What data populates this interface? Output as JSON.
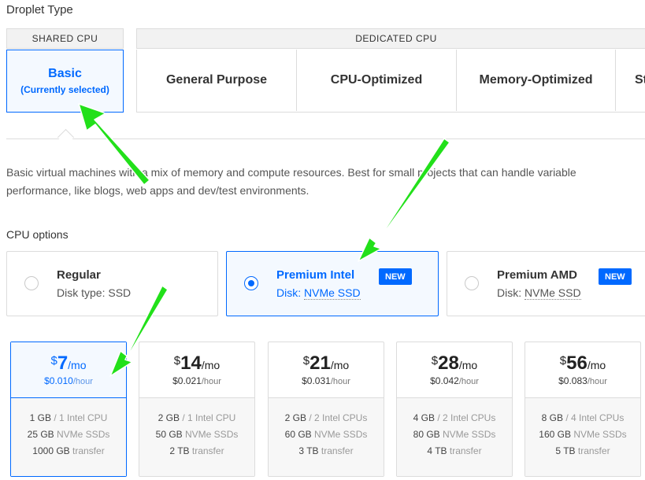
{
  "droplet_type": {
    "title": "Droplet Type"
  },
  "tabs": {
    "shared": {
      "header": "SHARED CPU",
      "name": "Basic",
      "status": "(Currently selected)"
    },
    "dedicated": {
      "header": "DEDICATED CPU",
      "items": [
        "General Purpose",
        "CPU-Optimized",
        "Memory-Optimized",
        "St"
      ]
    }
  },
  "description": {
    "line1": "Basic virtual machines with a mix of memory and compute resources. Best for small projects that can handle variable",
    "line2": "performance, like blogs, web apps and dev/test environments."
  },
  "cpu_options": {
    "title": "CPU options",
    "items": [
      {
        "name": "Regular",
        "disk_label": "Disk type: ",
        "disk": "SSD",
        "selected": false
      },
      {
        "name": "Premium Intel",
        "disk_label": "Disk: ",
        "disk": "NVMe SSD",
        "badge": "NEW",
        "selected": true
      },
      {
        "name": "Premium AMD",
        "disk_label": "Disk: ",
        "disk": "NVMe SSD",
        "badge": "NEW",
        "selected": false
      }
    ]
  },
  "plans": [
    {
      "currency": "$",
      "price": "7",
      "period": "/mo",
      "hourly": "$0.010",
      "hourly_unit": "/hour",
      "memory": "1 GB",
      "cpu": " / 1 Intel CPU",
      "disk": "25 GB",
      "disk_type": " NVMe SSDs",
      "transfer": "1000 GB",
      "transfer_label": " transfer",
      "selected": true
    },
    {
      "currency": "$",
      "price": "14",
      "period": "/mo",
      "hourly": "$0.021",
      "hourly_unit": "/hour",
      "memory": "2 GB",
      "cpu": " / 1 Intel CPU",
      "disk": "50 GB",
      "disk_type": " NVMe SSDs",
      "transfer": "2 TB",
      "transfer_label": " transfer",
      "selected": false
    },
    {
      "currency": "$",
      "price": "21",
      "period": "/mo",
      "hourly": "$0.031",
      "hourly_unit": "/hour",
      "memory": "2 GB",
      "cpu": " / 2 Intel CPUs",
      "disk": "60 GB",
      "disk_type": " NVMe SSDs",
      "transfer": "3 TB",
      "transfer_label": " transfer",
      "selected": false
    },
    {
      "currency": "$",
      "price": "28",
      "period": "/mo",
      "hourly": "$0.042",
      "hourly_unit": "/hour",
      "memory": "4 GB",
      "cpu": " / 2 Intel CPUs",
      "disk": "80 GB",
      "disk_type": " NVMe SSDs",
      "transfer": "4 TB",
      "transfer_label": " transfer",
      "selected": false
    },
    {
      "currency": "$",
      "price": "56",
      "period": "/mo",
      "hourly": "$0.083",
      "hourly_unit": "/hour",
      "memory": "8 GB",
      "cpu": " / 4 Intel CPUs",
      "disk": "160 GB",
      "disk_type": " NVMe SSDs",
      "transfer": "5 TB",
      "transfer_label": " transfer",
      "selected": false
    }
  ],
  "colors": {
    "accent": "#0069ff",
    "annotation_arrow": "#22e01a"
  },
  "annotations": {
    "arrow_icon": "green-arrow-icon"
  }
}
